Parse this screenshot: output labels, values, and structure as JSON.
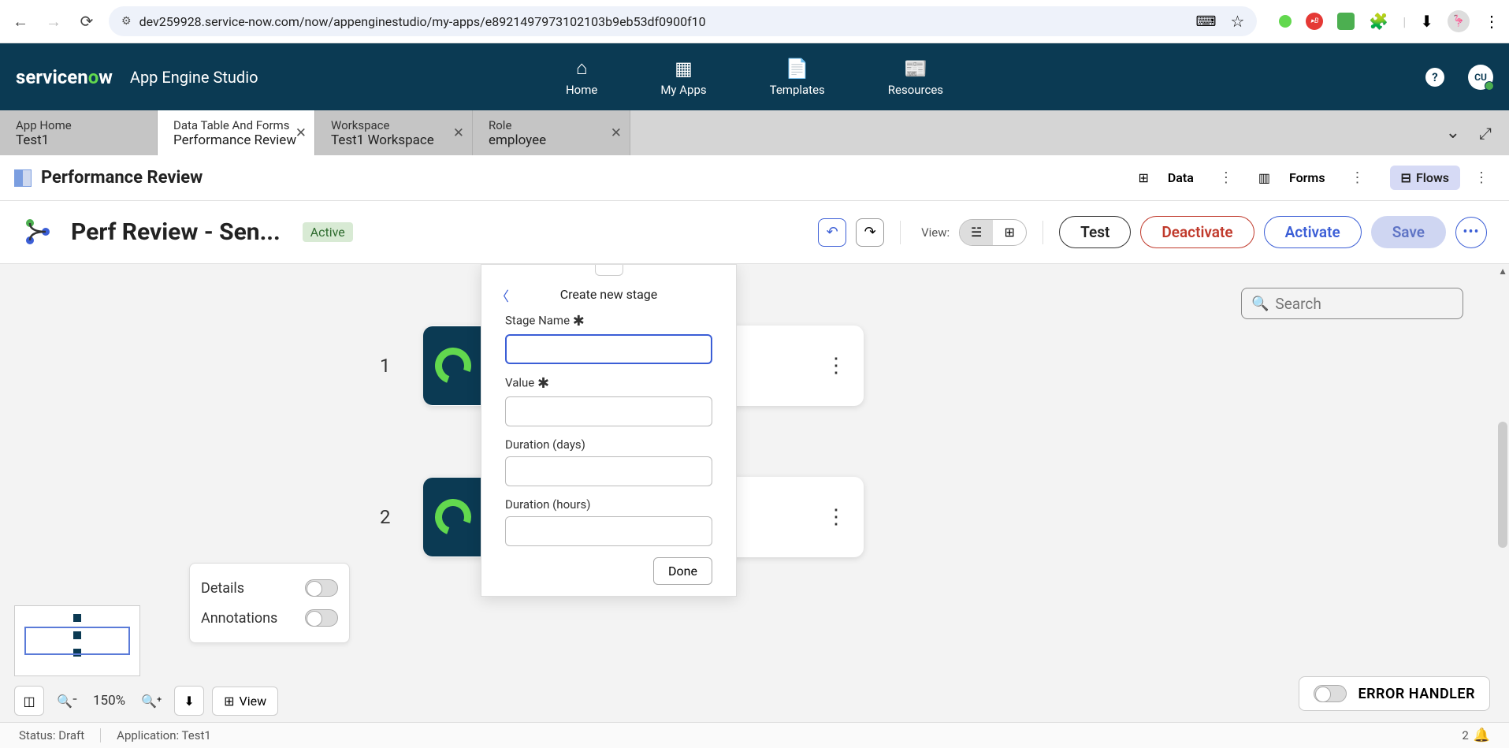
{
  "browser": {
    "url": "dev259928.service-now.com/now/appenginestudio/my-apps/e8921497973102103b9eb53df0900f10"
  },
  "header": {
    "logo_prefix": "service",
    "logo_mid": "n",
    "logo_o": "o",
    "logo_suffix": "w",
    "app_name": "App Engine Studio",
    "nav": [
      {
        "label": "Home",
        "icon": "home-icon"
      },
      {
        "label": "My Apps",
        "icon": "apps-icon"
      },
      {
        "label": "Templates",
        "icon": "templates-icon"
      },
      {
        "label": "Resources",
        "icon": "resources-icon"
      }
    ],
    "avatar": "CU"
  },
  "tabs": [
    {
      "type": "App Home",
      "title": "Test1",
      "closable": false
    },
    {
      "type": "Data Table And Forms",
      "title": "Performance Review",
      "closable": true,
      "active": true
    },
    {
      "type": "Workspace",
      "title": "Test1 Workspace",
      "closable": true
    },
    {
      "type": "Role",
      "title": "employee",
      "closable": true
    }
  ],
  "subheader": {
    "title": "Performance Review",
    "actions": {
      "data": "Data",
      "forms": "Forms",
      "flows": "Flows"
    }
  },
  "flow_toolbar": {
    "title": "Perf Review - Sen...",
    "status": "Active",
    "view_label": "View:",
    "buttons": {
      "test": "Test",
      "deactivate": "Deactivate",
      "activate": "Activate",
      "save": "Save"
    }
  },
  "canvas": {
    "cards": [
      {
        "num": "1"
      },
      {
        "num": "2"
      }
    ],
    "search_placeholder": "Search"
  },
  "popover": {
    "title": "Create new stage",
    "fields": {
      "stage_name": "Stage Name",
      "value": "Value",
      "duration_days": "Duration (days)",
      "duration_hours": "Duration (hours)"
    },
    "done": "Done"
  },
  "toggle_panel": {
    "details": "Details",
    "annotations": "Annotations"
  },
  "zoom": {
    "percent": "150%",
    "view_btn": "View"
  },
  "error_handler": "ERROR HANDLER",
  "footer": {
    "status": "Status: Draft",
    "application": "Application: Test1",
    "count": "2"
  }
}
